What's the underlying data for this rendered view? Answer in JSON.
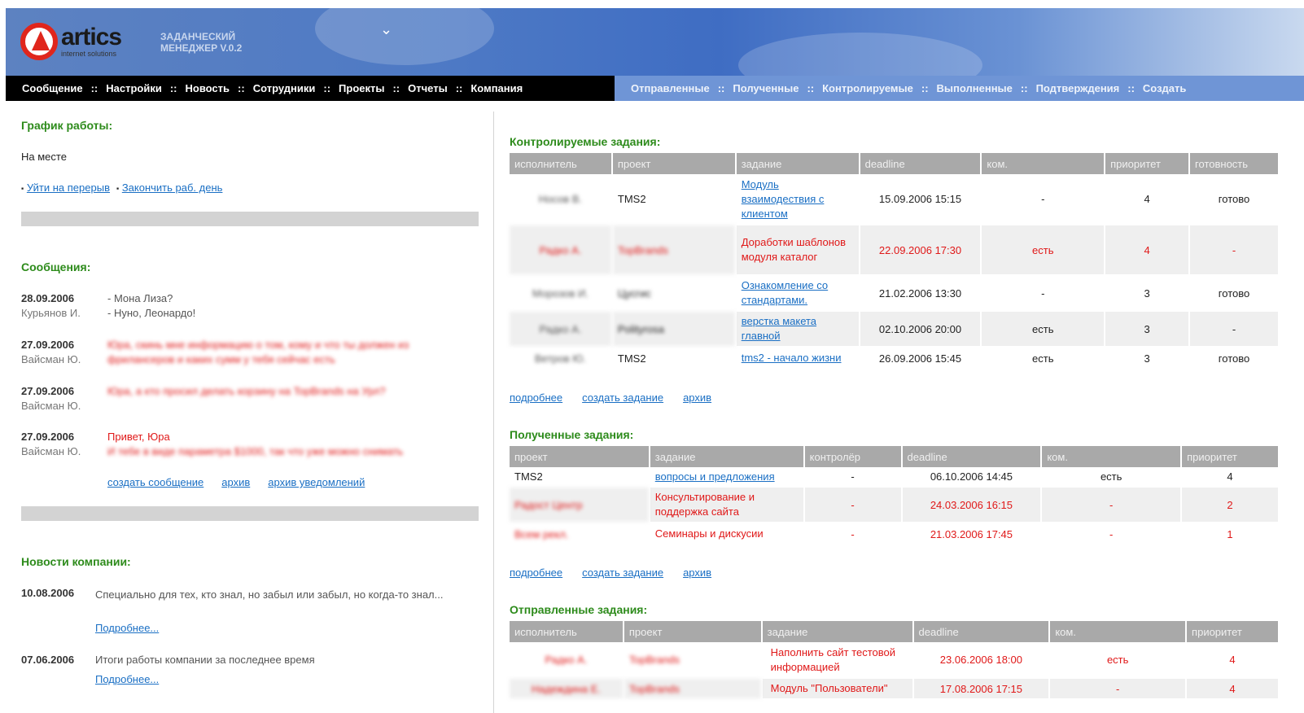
{
  "header": {
    "logo_brand": "artics",
    "logo_sub": "internet solutions",
    "app_title_1": "ЗАДАНЧЕСКИЙ",
    "app_title_2": "МЕНЕДЖЕР V.0.2"
  },
  "nav_left": [
    "Сообщение",
    "Настройки",
    "Новость",
    "Сотрудники",
    "Проекты",
    "Отчеты",
    "Компания"
  ],
  "nav_right": [
    "Отправленные",
    "Полученные",
    "Контролируемые",
    "Выполненные",
    "Подтверждения",
    "Создать"
  ],
  "nav_separator": "::",
  "schedule": {
    "title": "График работы:",
    "status": "На месте",
    "bullet": "▪",
    "break_link": "Уйти на перерыв",
    "end_day_link": "Закончить раб. день"
  },
  "messages": {
    "title": "Сообщения:",
    "items": [
      {
        "date": "28.09.2006",
        "author": "Курьянов И.",
        "line1": "- Мона Лиза?",
        "line2": "- Нуно, Леонардо!"
      },
      {
        "date": "27.09.2006",
        "author": "Вайсман Ю.",
        "line1": "Юра, скинь мне информацию о том, кому и что ты должен из",
        "line2": "фрилансеров и каких сумм у тебя сейчас есть"
      },
      {
        "date": "27.09.2006",
        "author": "Вайсман Ю.",
        "line1": "Юра, а кто просил делать корзину на TopBrands на Урл?",
        "line2": ""
      },
      {
        "date": "27.09.2006",
        "author": "Вайсман Ю.",
        "line1": "Привет, Юра",
        "line2": "И тебе в виде параметра $1000, так что уже можно снимать"
      }
    ],
    "create_link": "создать сообщение",
    "archive_link": "архив",
    "notifications_link": "архив уведомлений"
  },
  "news": {
    "title": "Новости компании:",
    "items": [
      {
        "date": "10.08.2006",
        "text": "Специально для тех, кто знал, но забыл или забыл, но когда-то знал...",
        "more": "Подробнее..."
      },
      {
        "date": "07.06.2006",
        "text": "Итоги работы компании за последнее время",
        "more": "Подробнее..."
      }
    ]
  },
  "controlled": {
    "title": "Контролируемые задания:",
    "headers": [
      "исполнитель",
      "проект",
      "задание",
      "deadline",
      "ком.",
      "приоритет",
      "готовность"
    ],
    "rows": [
      {
        "executor": "Носов В.",
        "project": "TMS2",
        "task": "Модуль взаимодествия с клиентом",
        "deadline": "15.09.2006 15:15",
        "com": "-",
        "priority": "4",
        "ready": "готово",
        "red": false,
        "alt": false
      },
      {
        "executor": "Радко А.",
        "project": "TopBrands",
        "task": "Доработки шаблонов модуля каталог",
        "deadline": "22.09.2006 17:30",
        "com": "есть",
        "priority": "4",
        "ready": "-",
        "red": true,
        "alt": true
      },
      {
        "executor": "Морозов И.",
        "project": "Цусгис",
        "task": "Ознакомление со стандартами.",
        "deadline": "21.02.2006 13:30",
        "com": "-",
        "priority": "3",
        "ready": "готово",
        "red": false,
        "alt": false
      },
      {
        "executor": "Радко А.",
        "project": "Polityrosa",
        "task": "верстка макета главной",
        "deadline": "02.10.2006 20:00",
        "com": "есть",
        "priority": "3",
        "ready": "-",
        "red": false,
        "alt": true
      },
      {
        "executor": "Ветров Ю.",
        "project": "TMS2",
        "task": "tms2 - начало жизни",
        "deadline": "26.09.2006 15:45",
        "com": "есть",
        "priority": "3",
        "ready": "готово",
        "red": false,
        "alt": false
      }
    ],
    "links": [
      "подробнее",
      "создать задание",
      "архив"
    ]
  },
  "received": {
    "title": "Полученные задания:",
    "headers": [
      "проект",
      "задание",
      "контролёр",
      "deadline",
      "ком.",
      "приоритет"
    ],
    "rows": [
      {
        "project": "TMS2",
        "task": "вопросы и предложения",
        "controller": "-",
        "deadline": "06.10.2006 14:45",
        "com": "есть",
        "priority": "4",
        "red": false,
        "alt": false
      },
      {
        "project": "Радост Центр",
        "task": "Консультирование и поддержка сайта",
        "controller": "-",
        "deadline": "24.03.2006 16:15",
        "com": "-",
        "priority": "2",
        "red": true,
        "alt": true
      },
      {
        "project": "Всем рекл.",
        "task": "Семинары и дискусии",
        "controller": "-",
        "deadline": "21.03.2006 17:45",
        "com": "-",
        "priority": "1",
        "red": true,
        "alt": false
      }
    ],
    "links": [
      "подробнее",
      "создать задание",
      "архив"
    ]
  },
  "sent": {
    "title": "Отправленные задания:",
    "headers": [
      "исполнитель",
      "проект",
      "задание",
      "deadline",
      "ком.",
      "приоритет"
    ],
    "rows": [
      {
        "executor": "Радко А.",
        "project": "TopBrands",
        "task": "Наполнить сайт тестовой информацией",
        "deadline": "23.06.2006 18:00",
        "com": "есть",
        "priority": "4",
        "red": true,
        "alt": false
      },
      {
        "executor": "Надеждина Е.",
        "project": "TopBrands",
        "task": "Модуль \"Пользователи\"",
        "deadline": "17.08.2006 17:15",
        "com": "-",
        "priority": "4",
        "red": true,
        "alt": true
      }
    ]
  }
}
